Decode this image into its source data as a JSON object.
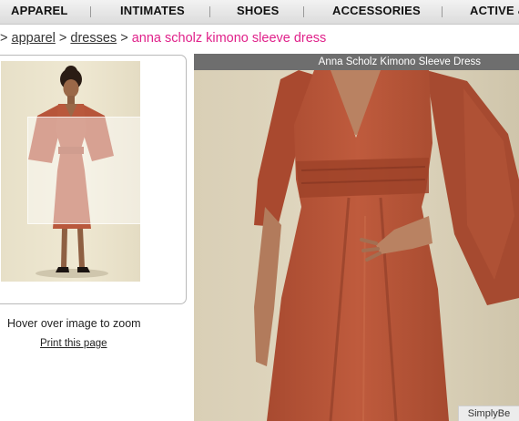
{
  "nav": {
    "items": [
      "APPAREL",
      "INTIMATES",
      "SHOES",
      "ACCESSORIES",
      "ACTIVE &"
    ]
  },
  "breadcrumb": {
    "separator": ">",
    "items": [
      "apparel",
      "dresses"
    ],
    "current": "anna scholz kimono sleeve dress"
  },
  "thumbnail": {
    "hint": "Hover over image to zoom",
    "print_link": "Print this page"
  },
  "zoom": {
    "title": "Anna Scholz Kimono Sleeve Dress",
    "brand": "SimplyBe"
  },
  "colors": {
    "accent_pink": "#e0218a",
    "dress_rust": "#b8583a",
    "title_bar": "#6e6e6e"
  }
}
